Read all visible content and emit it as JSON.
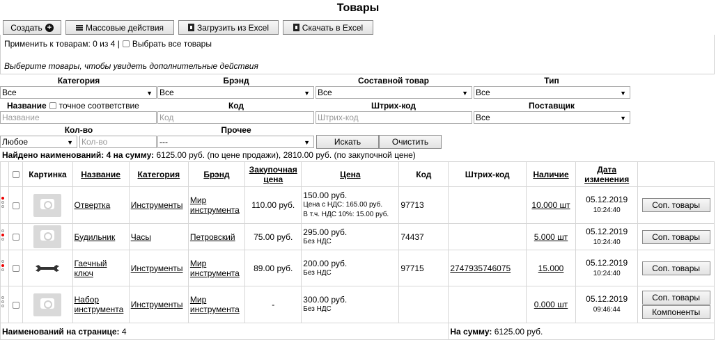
{
  "page": {
    "title": "Товары"
  },
  "toolbar": {
    "create": "Создать",
    "bulk": "Массовые действия",
    "upload": "Загрузить из Excel",
    "download": "Скачать в Excel"
  },
  "apply": {
    "text": "Применить к товарам: 0 из 4 |",
    "select_all": "Выбрать все товары",
    "hint": "Выберите товары, чтобы увидеть дополнительные действия"
  },
  "filters": {
    "category": {
      "label": "Категория",
      "value": "Все"
    },
    "brand": {
      "label": "Брэнд",
      "value": "Все"
    },
    "composite": {
      "label": "Составной товар",
      "value": "Все"
    },
    "type": {
      "label": "Тип",
      "value": "Все"
    },
    "name": {
      "label": "Название",
      "exact": "точное соответствие",
      "placeholder": "Название"
    },
    "code": {
      "label": "Код",
      "placeholder": "Код"
    },
    "barcode": {
      "label": "Штрих-код",
      "placeholder": "Штрих-код"
    },
    "supplier": {
      "label": "Поставщик",
      "value": "Все"
    },
    "qty": {
      "label": "Кол-во",
      "value": "Любое",
      "placeholder": "Кол-во"
    },
    "other": {
      "label": "Прочее",
      "value": "---"
    },
    "search_btn": "Искать",
    "clear_btn": "Очистить"
  },
  "summary": {
    "prefix": "Найдено наименований: 4 на сумму:",
    "rest": " 6125.00 руб. (по цене продажи), 2810.00 руб. (по закупочной цене)"
  },
  "table": {
    "headers": {
      "picture": "Картинка",
      "name": "Название",
      "category": "Категория",
      "brand": "Брэнд",
      "purchase": "Закупочная цена",
      "price": "Цена",
      "code": "Код",
      "barcode": "Штрих-код",
      "stock": "Наличие",
      "date": "Дата изменения"
    },
    "rows": [
      {
        "name": "Отвертка",
        "category": "Инструменты",
        "brand": "Мир инструмента",
        "purchase": "110.00 руб.",
        "price": "150.00 руб.",
        "price_note1": "Цена с НДС: 165.00 руб.",
        "price_note2": "В т.ч. НДС 10%: 15.00 руб.",
        "code": "97713",
        "barcode": "",
        "stock": "10.000 шт",
        "date": "05.12.2019",
        "time": "10:24:40",
        "btn1": "Соп. товары"
      },
      {
        "name": "Будильник",
        "category": "Часы",
        "brand": "Петровский",
        "purchase": "75.00 руб.",
        "price": "295.00 руб.",
        "price_note1": "Без НДС",
        "code": "74437",
        "barcode": "",
        "stock": "5.000 шт",
        "date": "05.12.2019",
        "time": "10:24:40",
        "btn1": "Соп. товары"
      },
      {
        "name": "Гаечный ключ",
        "category": "Инструменты",
        "brand": "Мир инструмента",
        "purchase": "89.00 руб.",
        "price": "200.00 руб.",
        "price_note1": "Без НДС",
        "code": "97715",
        "barcode": "2747935746075",
        "stock": "15.000",
        "date": "05.12.2019",
        "time": "10:24:40",
        "btn1": "Соп. товары"
      },
      {
        "name": "Набор инструмента",
        "category": "Инструменты",
        "brand": "Мир инструмента",
        "purchase": "-",
        "price": "300.00 руб.",
        "price_note1": "Без НДС",
        "code": "",
        "barcode": "",
        "stock": "0.000 шт",
        "date": "05.12.2019",
        "time": "09:46:44",
        "btn1": "Соп. товары",
        "btn2": "Компоненты"
      }
    ],
    "footer": {
      "count_label": "Наименований на странице:",
      "count": "4",
      "sum_label": "На сумму:",
      "sum": "6125.00 руб."
    }
  },
  "colors": {
    "status_dot": "#e00000",
    "border": "#d6d6d6"
  }
}
